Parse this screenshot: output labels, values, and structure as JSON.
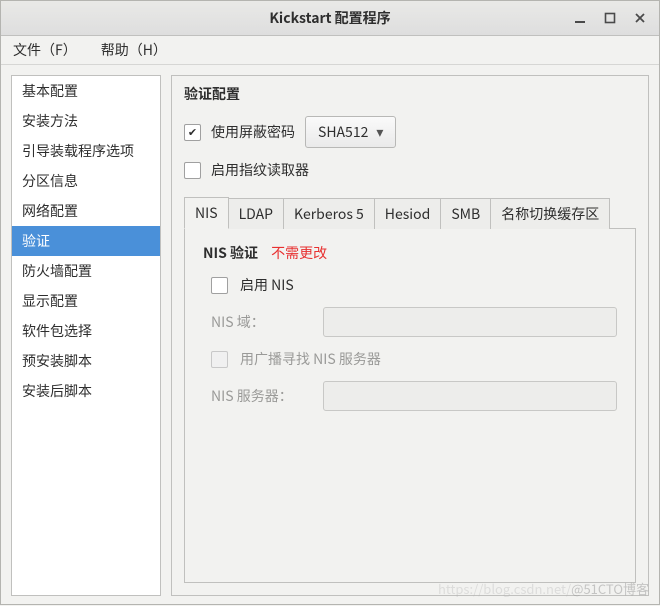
{
  "window": {
    "title": "Kickstart 配置程序"
  },
  "menubar": {
    "file": "文件（F）",
    "help": "帮助（H）"
  },
  "sidebar": {
    "items": [
      "基本配置",
      "安装方法",
      "引导装载程序选项",
      "分区信息",
      "网络配置",
      "验证",
      "防火墙配置",
      "显示配置",
      "软件包选择",
      "预安装脚本",
      "安装后脚本"
    ],
    "selected_index": 5
  },
  "content": {
    "heading": "验证配置",
    "options": {
      "use_shadow_label": "使用屏蔽密码",
      "use_shadow_checked": true,
      "hash_algo_selected": "SHA512",
      "fingerprint_label": "启用指纹读取器",
      "fingerprint_checked": false
    },
    "tabs": {
      "items": [
        "NIS",
        "LDAP",
        "Kerberos 5",
        "Hesiod",
        "SMB",
        "名称切换缓存区"
      ],
      "selected_index": 0
    },
    "nis": {
      "heading": "NIS 验证",
      "annotation": "不需更改",
      "enable_label": "启用 NIS",
      "enable_checked": false,
      "domain_label": "NIS 域：",
      "domain_value": "",
      "broadcast_label": "用广播寻找 NIS 服务器",
      "broadcast_checked": false,
      "server_label": "NIS 服务器：",
      "server_value": ""
    }
  },
  "watermark": {
    "faint": "https://blog.csdn.net/",
    "main": "@51CTO博客"
  }
}
